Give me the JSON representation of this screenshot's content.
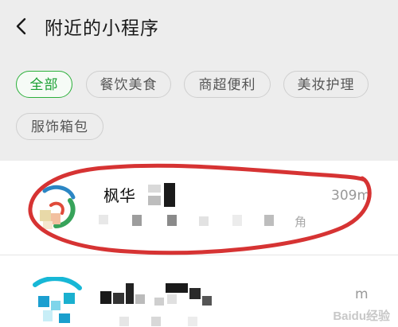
{
  "header": {
    "title": "附近的小程序",
    "back_icon": "chevron-left-icon"
  },
  "filters": [
    {
      "label": "全部",
      "active": true
    },
    {
      "label": "餐饮美食",
      "active": false
    },
    {
      "label": "商超便利",
      "active": false
    },
    {
      "label": "美妆护理",
      "active": false
    },
    {
      "label": "服饰箱包",
      "active": false
    }
  ],
  "list": [
    {
      "name": "枫华",
      "distance": "309m",
      "subtitle": "角"
    },
    {
      "name": "",
      "distance": "m",
      "subtitle": ""
    }
  ],
  "colors": {
    "accent": "#1aa032",
    "annotation": "#d63333",
    "header_bg": "#ededed"
  },
  "watermark": "Baidu经验"
}
